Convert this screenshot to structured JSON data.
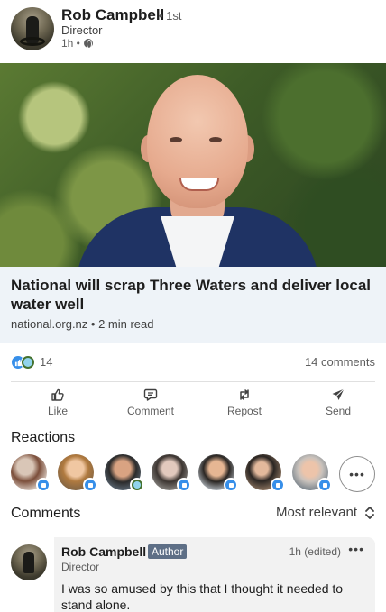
{
  "post": {
    "author": "Rob Campbell",
    "degree": "• 1st",
    "title": "Director",
    "time": "1h •"
  },
  "article": {
    "title": "National will scrap Three Waters and deliver local water well",
    "source": "national.org.nz",
    "read_time": "2 min read"
  },
  "engagement": {
    "reaction_count": "14",
    "comment_count": "14 comments",
    "reaction_icons": [
      "like-icon",
      "funny-icon"
    ]
  },
  "actions": [
    {
      "label": "Like",
      "icon": "thumbs-up-icon"
    },
    {
      "label": "Comment",
      "icon": "comment-icon"
    },
    {
      "label": "Repost",
      "icon": "repost-icon"
    },
    {
      "label": "Send",
      "icon": "send-icon"
    }
  ],
  "reactions": {
    "heading": "Reactions",
    "more_label": "•••",
    "reactors": [
      {
        "badge": "like"
      },
      {
        "badge": "like"
      },
      {
        "badge": "funny"
      },
      {
        "badge": "like"
      },
      {
        "badge": "like"
      },
      {
        "badge": "like"
      },
      {
        "badge": "like"
      }
    ]
  },
  "comments": {
    "heading": "Comments",
    "sort_label": "Most relevant",
    "items": [
      {
        "author": "Rob Campbell",
        "badge": "Author",
        "title": "Director",
        "time": "1h (edited)",
        "more": "•••",
        "text": "I was so amused by this that I thought it needed to stand alone."
      }
    ]
  },
  "colors": {
    "accent": "#378fe9",
    "card_background": "#eef3f8",
    "author_badge": "#5e6f86"
  }
}
